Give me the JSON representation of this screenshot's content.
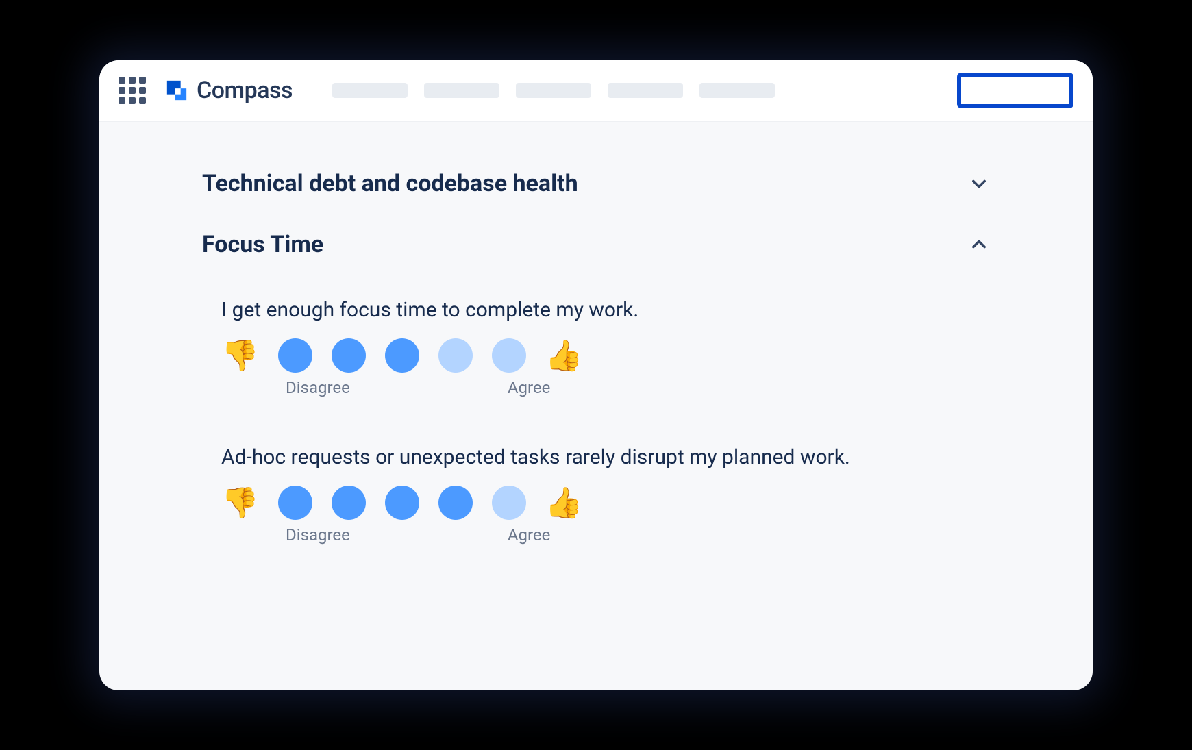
{
  "brand": {
    "name": "Compass"
  },
  "sections": [
    {
      "title": "Technical debt and codebase health",
      "expanded": false
    },
    {
      "title": "Focus Time",
      "expanded": true
    }
  ],
  "questions": [
    {
      "text": "I get enough focus time to complete my work.",
      "rating": {
        "filled": 3,
        "total": 5
      },
      "labels": {
        "left": "Disagree",
        "right": "Agree"
      },
      "icons": {
        "left": "👎",
        "right": "👍"
      }
    },
    {
      "text": "Ad-hoc requests or unexpected tasks rarely disrupt my planned work.",
      "rating": {
        "filled": 4,
        "total": 5
      },
      "labels": {
        "left": "Disagree",
        "right": "Agree"
      },
      "icons": {
        "left": "👎",
        "right": "👍"
      }
    }
  ]
}
